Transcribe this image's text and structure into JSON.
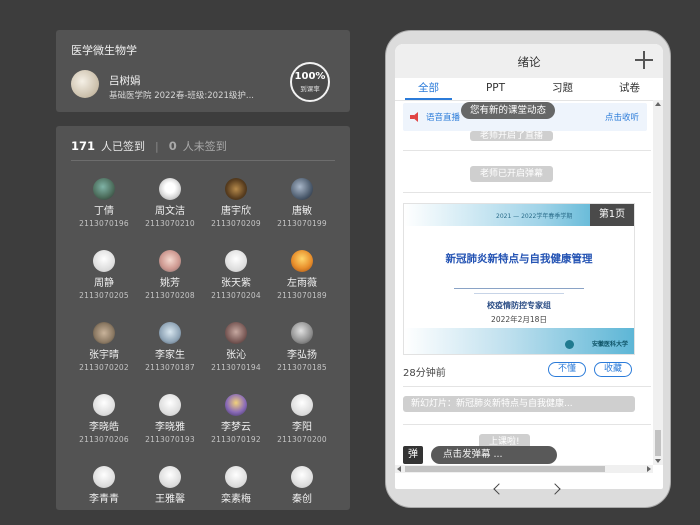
{
  "course": {
    "title": "医学微生物学",
    "teacher": "吕树娟",
    "subtitle": "基础医学院 2022春-班级:2021级护...",
    "rate_value": "100%",
    "rate_label": "到课率"
  },
  "signin": {
    "signed_count": "171",
    "signed_label": "人已签到",
    "separator": "|",
    "unsigned_count": "0",
    "unsigned_label": "人未签到",
    "students": [
      {
        "name": "丁倩",
        "id": "2113070196"
      },
      {
        "name": "周文洁",
        "id": "2113070210"
      },
      {
        "name": "唐宇欣",
        "id": "2113070209"
      },
      {
        "name": "唐敏",
        "id": "2113070199"
      },
      {
        "name": "周静",
        "id": "2113070205"
      },
      {
        "name": "姚芳",
        "id": "2113070208"
      },
      {
        "name": "张天紫",
        "id": "2113070204"
      },
      {
        "name": "左雨薇",
        "id": "2113070189"
      },
      {
        "name": "张宇晴",
        "id": "2113070202"
      },
      {
        "name": "李家生",
        "id": "2113070187"
      },
      {
        "name": "张沁",
        "id": "2113070194"
      },
      {
        "name": "李弘扬",
        "id": "2113070185"
      },
      {
        "name": "李晓皓",
        "id": "2113070206"
      },
      {
        "name": "李晓雅",
        "id": "2113070193"
      },
      {
        "name": "李梦云",
        "id": "2113070192"
      },
      {
        "name": "李阳",
        "id": "2113070200"
      },
      {
        "name": "李青青",
        "id": ""
      },
      {
        "name": "王雅馨",
        "id": ""
      },
      {
        "name": "栾素梅",
        "id": ""
      },
      {
        "name": "秦创",
        "id": ""
      }
    ]
  },
  "phone": {
    "title": "绪论",
    "tabs": [
      "全部",
      "PPT",
      "习题",
      "试卷"
    ],
    "notice_text": "语音直播",
    "notice_link": "点击收听",
    "toast_top": "您有新的课堂动态",
    "event_live": "老师开启了直播",
    "event_danmu": "老师已开启弹幕",
    "slide": {
      "page": "第1页",
      "year": "2021 — 2022学年春季学期",
      "title": "新冠肺炎新特点与自我健康管理",
      "org": "校疫情防控专家组",
      "date": "2022年2月18日",
      "logo": "安徽医科大学"
    },
    "time_ago": "28分钟前",
    "btn_unclear": "不懂",
    "btn_collect": "收藏",
    "new_slide": "新幻灯片：新冠肺炎新特点与自我健康...",
    "class_start": "上课啦!",
    "danmu_badge": "弹",
    "danmu_placeholder": "点击发弹幕 ..."
  }
}
